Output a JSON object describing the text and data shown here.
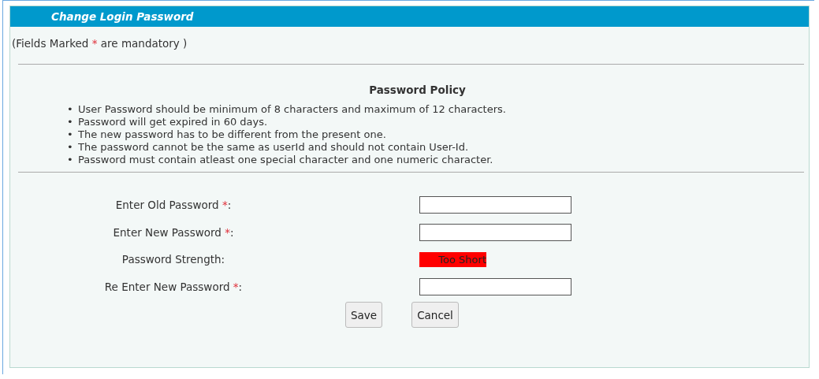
{
  "panel": {
    "title": "Change Login Password"
  },
  "note": {
    "before": "(Fields Marked ",
    "mark": "*",
    "after": " are mandatory )"
  },
  "policy": {
    "heading": "Password Policy",
    "bullet": "•",
    "items": [
      "User Password should be minimum of 8 characters and maximum of 12 characters.",
      "Password will get expired in 60 days.",
      "The new password has to be different from the present one.",
      "The password cannot be the same as userId and should not contain User-Id.",
      "Password must contain atleast one special character and one numeric character."
    ]
  },
  "form": [
    {
      "kind": "input",
      "label": "Enter Old Password ",
      "mark": "*",
      "suffix": ":"
    },
    {
      "kind": "input",
      "label": "Enter New Password ",
      "mark": "*",
      "suffix": ":"
    },
    {
      "kind": "strength",
      "label": "Password Strength:",
      "value": "Too Short"
    },
    {
      "kind": "input",
      "label": "Re Enter New Password ",
      "mark": "*",
      "suffix": ":"
    }
  ],
  "buttons": [
    "Save",
    "Cancel"
  ]
}
